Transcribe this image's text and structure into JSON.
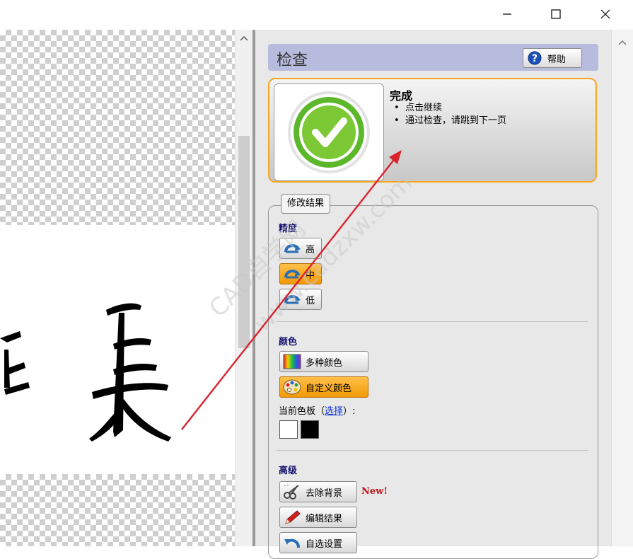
{
  "window": {
    "controls": {
      "minimize": "minimize",
      "maximize": "maximize",
      "close": "close"
    }
  },
  "preview": {
    "visible_text": "長"
  },
  "panel": {
    "header": {
      "title": "检查",
      "help_label": "帮助"
    },
    "status": {
      "title": "完成",
      "bullets": [
        "点击继续",
        "通过检查，请跳到下一页"
      ]
    },
    "group_title": "修改结果",
    "precision": {
      "title": "精度",
      "options": [
        {
          "label": "高",
          "selected": false
        },
        {
          "label": "中",
          "selected": true
        },
        {
          "label": "低",
          "selected": false
        }
      ]
    },
    "color": {
      "title": "颜色",
      "options": [
        {
          "label": "多种颜色",
          "selected": false
        },
        {
          "label": "自定义颜色",
          "selected": true
        }
      ],
      "palette_label_prefix": "当前色板（",
      "palette_link": "选择",
      "palette_label_suffix": "）:",
      "swatches": [
        "#ffffff",
        "#000000"
      ]
    },
    "advanced": {
      "title": "高级",
      "options": [
        {
          "label": "去除背景"
        },
        {
          "label": "编辑结果"
        },
        {
          "label": "自选设置"
        }
      ],
      "new_badge": "New!"
    }
  },
  "overlay": {
    "watermark_line1": "CAD自学网",
    "watermark_line2": "www.cadzxw.com",
    "annotation_color": "#d9232d"
  },
  "colors": {
    "accent_orange": "#f29a05",
    "header_bg": "#b7bbdd",
    "section_title": "#10106e",
    "link": "#0a2fd6"
  }
}
